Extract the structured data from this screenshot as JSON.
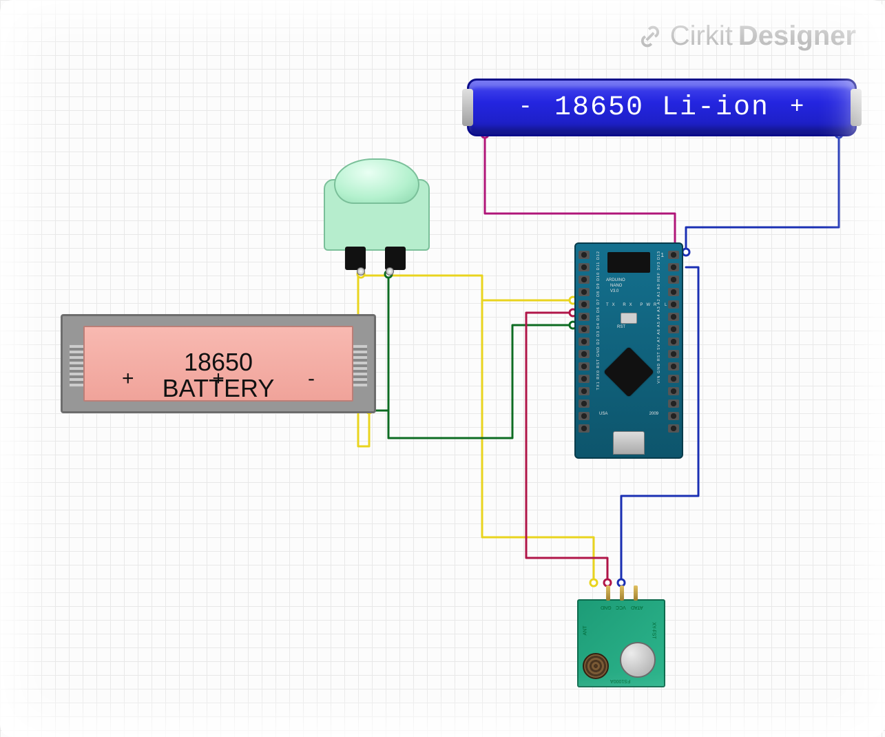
{
  "watermark": {
    "brand": "Cirkit",
    "product": "Designer"
  },
  "components": {
    "liion_battery": {
      "type": "lithium-ion-cell",
      "label": "18650 Li-ion",
      "terminals": {
        "negative": "-",
        "positive": "+"
      }
    },
    "arcade_button": {
      "type": "arcade-pushbutton",
      "color": "#b6edcd",
      "pins": [
        "left",
        "right"
      ]
    },
    "battery_holder": {
      "type": "18650-holder",
      "label_line1": "18650",
      "label_line2": "BATTERY",
      "plus": "+",
      "minus": "-",
      "center_plus": "+"
    },
    "arduino_nano": {
      "type": "arduino-nano-v3",
      "silk_title": "ARDUINO",
      "silk_sub": "NANO",
      "silk_ver": "V3.0",
      "footer_left": "USA",
      "footer_right": "2009",
      "rst_label": "RST",
      "led_labels": [
        "TX",
        "RX",
        "PWR",
        "L"
      ],
      "top_right_1": "1",
      "left_pins": [
        "TX1",
        "RX0",
        "RST",
        "GND",
        "D2",
        "D3",
        "D4",
        "D5",
        "D6",
        "D7",
        "D8",
        "D9",
        "D10",
        "D11",
        "D12"
      ],
      "right_pins": [
        "VIN",
        "GND",
        "RST",
        "5V",
        "A7",
        "A6",
        "A5",
        "A4",
        "A3",
        "A2",
        "A1",
        "A0",
        "REF",
        "3V3",
        "D13"
      ]
    },
    "rf_transmitter": {
      "type": "433mhz-tx",
      "board_label": "FS1000A",
      "side_label": "XY-FST",
      "pin_labels": [
        "GND",
        "VCC",
        "ATAD"
      ],
      "ant_label": "ANT"
    }
  },
  "wires": [
    {
      "id": "liion-neg-to-nano-gnd",
      "color": "#b01578",
      "from": "liion.-",
      "to": "nano.GND(right)"
    },
    {
      "id": "liion-pos-to-nano-vin",
      "color": "#1a2fb3",
      "from": "liion.+",
      "to": "nano.VIN"
    },
    {
      "id": "button-L-to-nano-d2",
      "color": "#e9d41e",
      "from": "arcade.left",
      "to": "nano.D2"
    },
    {
      "id": "button-R-to-nano-d4",
      "color": "#0d6b22",
      "from": "arcade.right",
      "to": "nano.D4"
    },
    {
      "id": "holder-pos-to-button-L",
      "color": "#e9d41e",
      "from": "holder.+",
      "to": "arcade.left"
    },
    {
      "id": "holder-neg-to-button-R",
      "color": "#0d6b22",
      "from": "holder.-",
      "to": "arcade.right"
    },
    {
      "id": "nano-d2-to-rf-gnd",
      "color": "#e9d41e",
      "from": "nano.D2",
      "to": "rf.GND"
    },
    {
      "id": "nano-d3-to-rf-vcc",
      "color": "#b01548",
      "from": "nano.D3",
      "to": "rf.VCC"
    },
    {
      "id": "nano-vin-to-rf-data",
      "color": "#1a2fb3",
      "from": "nano.VIN",
      "to": "rf.ATAD"
    }
  ],
  "colors": {
    "wire_yellow": "#e9d41e",
    "wire_green": "#0d6b22",
    "wire_magenta": "#b01578",
    "wire_crimson": "#b01548",
    "wire_blue": "#1a2fb3"
  }
}
